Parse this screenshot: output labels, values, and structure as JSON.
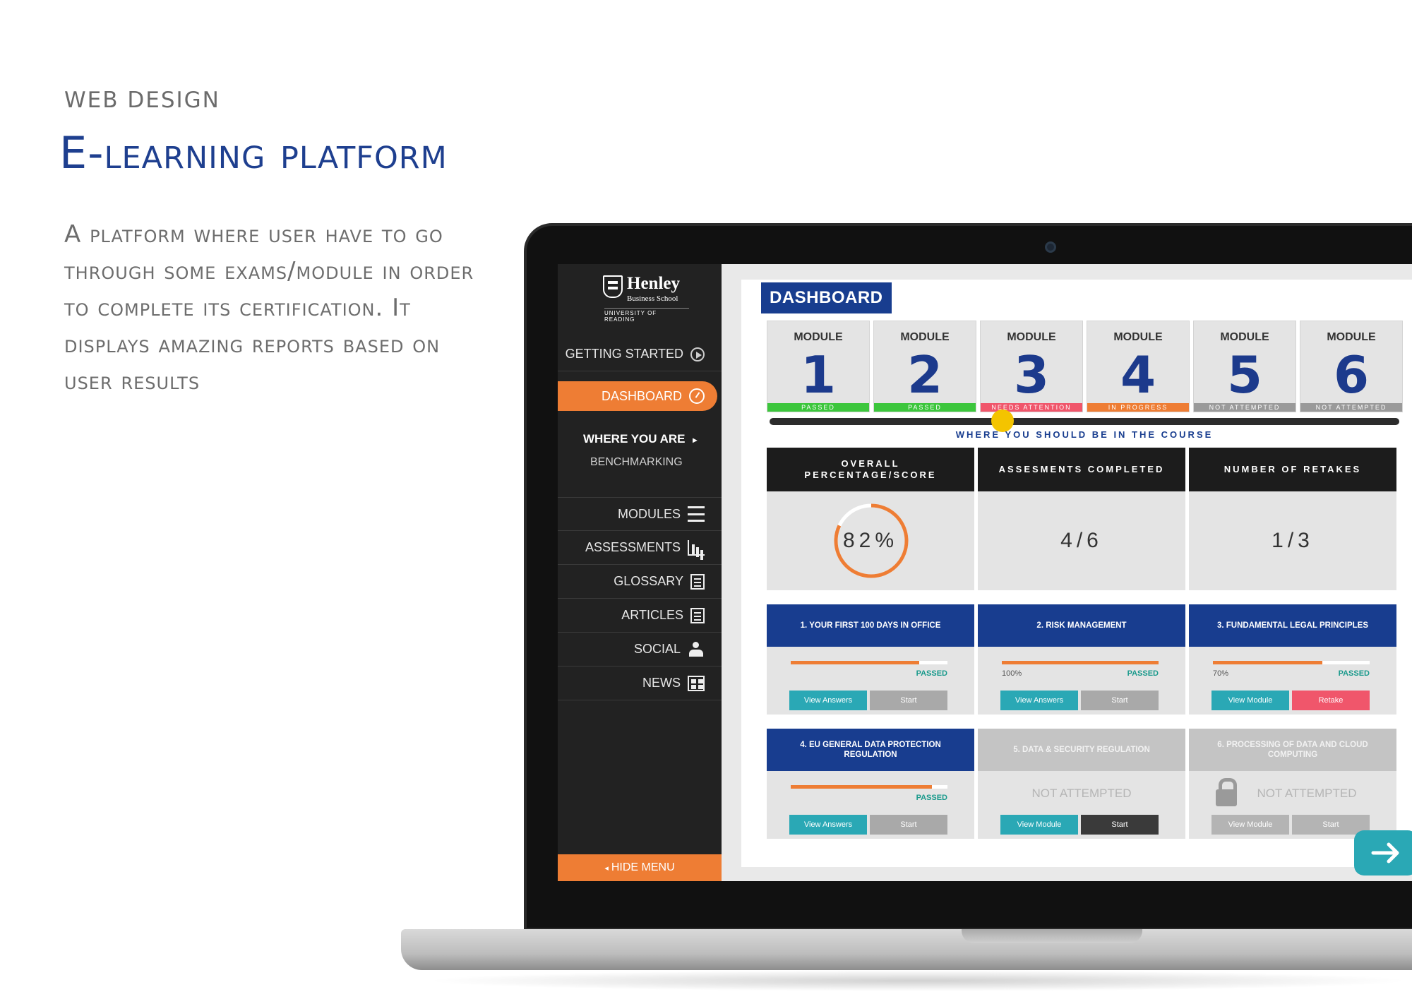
{
  "page": {
    "eyebrow": "WEB DESIGN",
    "headline": "E-learning platform",
    "description": "A platform where user have to go through some exams/module in order to complete its certification. It displays amazing reports based on user results"
  },
  "logo": {
    "name": "Henley",
    "sub": "Business School",
    "university": "UNIVERSITY OF READING"
  },
  "sidebar": {
    "getting_started": "GETTING STARTED",
    "dashboard": "DASHBOARD",
    "where_you_are": "WHERE YOU ARE",
    "benchmarking": "BENCHMARKING",
    "items": [
      {
        "label": "MODULES",
        "icon": "stack-icon"
      },
      {
        "label": "ASSESSMENTS",
        "icon": "chart-icon"
      },
      {
        "label": "GLOSSARY",
        "icon": "search-doc-icon"
      },
      {
        "label": "ARTICLES",
        "icon": "document-icon"
      },
      {
        "label": "SOCIAL",
        "icon": "people-icon"
      },
      {
        "label": "NEWS",
        "icon": "newspaper-icon"
      }
    ],
    "hide_menu": "HIDE MENU"
  },
  "dashboard": {
    "title": "DASHBOARD",
    "modules": [
      {
        "label": "MODULE",
        "number": "1",
        "status": "PASSED",
        "color": "#3cc63c"
      },
      {
        "label": "MODULE",
        "number": "2",
        "status": "PASSED",
        "color": "#3cc63c"
      },
      {
        "label": "MODULE",
        "number": "3",
        "status": "NEEDS ATTENTION",
        "color": "#f0566b"
      },
      {
        "label": "MODULE",
        "number": "4",
        "status": "IN PROGRESS",
        "color": "#ee7d34"
      },
      {
        "label": "MODULE",
        "number": "5",
        "status": "NOT ATTEMPTED",
        "color": "#9a9a9a"
      },
      {
        "label": "MODULE",
        "number": "6",
        "status": "NOT ATTEMPTED",
        "color": "#9a9a9a"
      }
    ],
    "track_label": "WHERE YOU SHOULD BE IN THE COURSE",
    "track_progress": 0.37,
    "stats": [
      {
        "title": "OVERALL PERCENTAGE/SCORE",
        "value": "82%",
        "progress": 0.82
      },
      {
        "title": "ASSESMENTS COMPLETED",
        "value": "4/6"
      },
      {
        "title": "NUMBER OF RETAKES",
        "value": "1/3"
      }
    ],
    "courses": [
      {
        "title": "1. YOUR FIRST 100 DAYS IN OFFICE",
        "progress": 0.82,
        "pct": "",
        "status": "PASSED",
        "btn1": "View Answers",
        "btn2": "Start"
      },
      {
        "title": "2. RISK MANAGEMENT",
        "progress": 1.0,
        "pct": "100%",
        "status": "PASSED",
        "btn1": "View Answers",
        "btn2": "Start"
      },
      {
        "title": "3. FUNDAMENTAL LEGAL PRINCIPLES",
        "progress": 0.7,
        "pct": "70%",
        "status": "PASSED",
        "btn1": "View Module",
        "btn2": "Retake"
      },
      {
        "title": "4. EU GENERAL DATA PROTECTION REGULATION",
        "progress": 0.9,
        "pct": "",
        "status": "PASSED",
        "btn1": "View Answers",
        "btn2": "Start"
      },
      {
        "title": "5. DATA & SECURITY REGULATION",
        "status_text": "NOT ATTEMPTED",
        "btn1": "View Module",
        "btn2": "Start"
      },
      {
        "title": "6. PROCESSING OF DATA AND CLOUD COMPUTING",
        "status_text": "NOT ATTEMPTED",
        "btn1": "View Module",
        "btn2": "Start"
      }
    ]
  },
  "colors": {
    "brand_blue": "#183d8f",
    "accent_orange": "#ee7d34",
    "teal": "#2aa8b5",
    "sidebar": "#222222"
  }
}
